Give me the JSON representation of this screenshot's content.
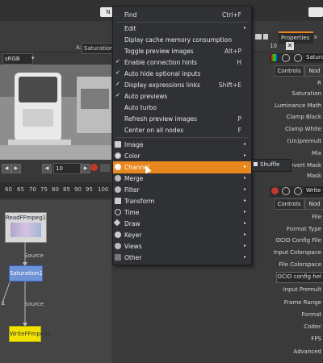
{
  "top": {
    "title_fragment": "N"
  },
  "viewer": {
    "colorspace": "sRGB",
    "input_a_label": "A:",
    "input_a_value": "Saturation",
    "frame": "10",
    "ruler_ticks": [
      "60",
      "65",
      "70",
      "75",
      "80",
      "85",
      "90",
      "95",
      "100"
    ]
  },
  "graph": {
    "read_node": "ReadFFmpeg1",
    "sat_node": "Saturation1",
    "write_node": "WriteFFmpeg1",
    "edge1_label": "Source",
    "edge2_label": "Source",
    "edge3_label": "1"
  },
  "menu": {
    "items": [
      {
        "label": "Find",
        "shortcut": "Ctrl+F"
      },
      {
        "label": "Edit"
      },
      {
        "label": "Diplay cache memory consumption"
      },
      {
        "label": "Toggle preview images",
        "shortcut": "Alt+P"
      },
      {
        "label": "Enable connection hints",
        "shortcut": "H"
      },
      {
        "label": "Auto hide optional inputs"
      },
      {
        "label": "Display expressions links",
        "shortcut": "Shift+E"
      },
      {
        "label": "Auto previews"
      },
      {
        "label": "Auto turbo"
      },
      {
        "label": "Refresh preview images",
        "shortcut": "P"
      },
      {
        "label": "Center on all nodes",
        "shortcut": "F"
      },
      {
        "label": "Image"
      },
      {
        "label": "Color"
      },
      {
        "label": "Channel"
      },
      {
        "label": "Merge"
      },
      {
        "label": "Filter"
      },
      {
        "label": "Transform"
      },
      {
        "label": "Time"
      },
      {
        "label": "Draw"
      },
      {
        "label": "Keyer"
      },
      {
        "label": "Views"
      },
      {
        "label": "Other"
      }
    ],
    "submenu_item": "Shuffle",
    "highlight_color": "#e8871e"
  },
  "panel": {
    "properties_tab": "Properties",
    "number": "10",
    "node_name_1": "Satura",
    "controls_tab_1": "Controls",
    "node_tab_1": "Nod",
    "rows_1": [
      "R",
      "Saturation",
      "Luminance Math",
      "Clamp Black",
      "Clamp White",
      "(Un)premult",
      "Mix",
      "nvert Mask",
      "Mask"
    ],
    "node_name_2": "Write",
    "controls_tab_2": "Controls",
    "node_tab_2": "Nod",
    "rows_2": [
      "File",
      "Format Type",
      "OCIO Config File",
      "Input Colorspace",
      "File Colorspace",
      "OCIO config hel",
      "Input Premult",
      "Frame Range",
      "Format",
      "Codec",
      "FPS",
      "Advanced"
    ],
    "cut_labels": [
      "Mask"
    ]
  }
}
